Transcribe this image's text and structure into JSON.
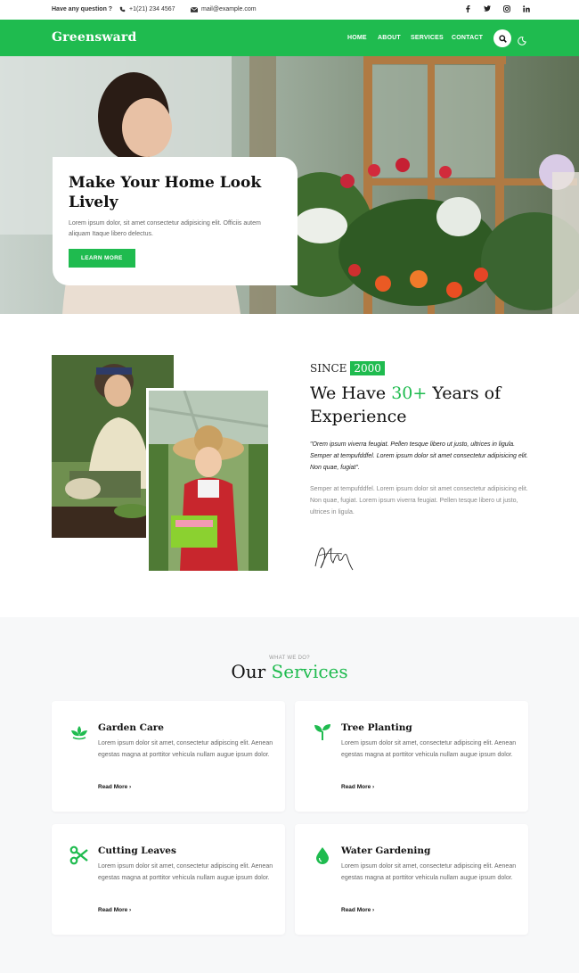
{
  "topbar": {
    "question": "Have any question ?",
    "phone": "+1(21) 234 4567",
    "email": "mail@example.com",
    "social": [
      "f",
      "t",
      "ig",
      "in"
    ]
  },
  "nav": {
    "logo": "Greensward",
    "links": [
      "HOME",
      "ABOUT",
      "SERVICES",
      "CONTACT"
    ]
  },
  "hero": {
    "title": "Make Your Home Look Lively",
    "text": "Lorem ipsum dolor, sit amet consectetur adipisicing elit. Officiis autem aliquam Itaque libero delectus.",
    "button": "LEARN MORE"
  },
  "about": {
    "since_label": "SINCE",
    "since_year": "2000",
    "title_prefix": "We Have ",
    "title_highlight": "30+",
    "title_suffix": " Years of Experience",
    "quote": "\"Orem ipsum viverra feugiat. Pellen tesque libero ut justo, ultrices in ligula. Semper at tempufddfel. Lorem ipsum dolor sit amet consectetur adipisicing elit. Non quae, fugiat\".",
    "text": "Semper at tempufddfel. Lorem ipsum dolor sit amet consectetur adipisicing elit. Non quae, fugiat. Lorem ipsum viverra feugiat. Pellen tesque libero ut justo, ultrices in ligula."
  },
  "services": {
    "kicker": "WHAT WE DO?",
    "title_prefix": "Our ",
    "title_highlight": "Services",
    "cards": [
      {
        "title": "Garden Care",
        "text": "Lorem ipsum dolor sit amet, consectetur adipiscing elit. Aenean egestas magna at porttitor vehicula nullam augue ipsum dolor.",
        "more": "Read More",
        "icon": "lotus-icon"
      },
      {
        "title": "Tree Planting",
        "text": "Lorem ipsum dolor sit amet, consectetur adipiscing elit. Aenean egestas magna at porttitor vehicula nullam augue ipsum dolor.",
        "more": "Read More",
        "icon": "sprout-icon"
      },
      {
        "title": "Cutting Leaves",
        "text": "Lorem ipsum dolor sit amet, consectetur adipiscing elit. Aenean egestas magna at porttitor vehicula nullam augue ipsum dolor.",
        "more": "Read More",
        "icon": "scissors-icon"
      },
      {
        "title": "Water Gardening",
        "text": "Lorem ipsum dolor sit amet, consectetur adipiscing elit. Aenean egestas magna at porttitor vehicula nullam augue ipsum dolor.",
        "more": "Read More",
        "icon": "water-drop-icon"
      }
    ]
  },
  "colors": {
    "accent": "#1fbb4f"
  }
}
